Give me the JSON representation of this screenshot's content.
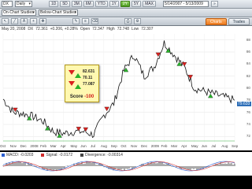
{
  "toolbar": {
    "symbol": "DX",
    "period": "Daily",
    "studies_dropdown": "On-Chart Studies",
    "below_studies_dropdown": "Below-Chart Studies",
    "ranges": [
      "1D",
      "5D",
      "3M",
      "6M",
      "YTD",
      "1Y",
      "2Y",
      "5Y",
      "MAX"
    ],
    "active_range": "2Y",
    "date_range": "5/14/2007 - 5/13/2009",
    "tabs": [
      "Charts",
      "Trades"
    ],
    "active_tab": "Charts"
  },
  "chart_header": {
    "date": "May 20, 2008",
    "symbol": "DX",
    "last": "72.361",
    "change": "+0.206, +0.28%",
    "open_label": "Open",
    "open": "72.347",
    "high_label": "High",
    "high": "72.748",
    "low_label": "Low",
    "low": "72.307",
    "close_label": "Close",
    "close": "72.361"
  },
  "score_box": {
    "values": [
      "82.631",
      "70.11",
      "77.087"
    ],
    "score_label": "Score",
    "score_value": "-100"
  },
  "price_flag": "79.633",
  "y_ticks": [
    "88",
    "86",
    "84",
    "82",
    "80",
    "78",
    "76",
    "74",
    "72"
  ],
  "x_ticks": [
    "Oct",
    "Nov",
    "Dec",
    "2008",
    "Feb",
    "Mar",
    "Apr",
    "May",
    "Jun",
    "Jul",
    "Aug",
    "Sep",
    "Oct",
    "Nov",
    "Dec",
    "2009",
    "Feb",
    "Mar",
    "Apr",
    "May",
    "Jun",
    "Jul",
    "Aug",
    "Sep"
  ],
  "macd": {
    "label": "MACD: -0.0203",
    "signal_label": "Signal: -0.0172",
    "divergence_label": "Divergence: -0.00314",
    "colors": {
      "macd": "#2b5fd1",
      "signal": "#d02b2b",
      "divergence": "#444444"
    }
  },
  "chart_data": {
    "type": "line",
    "x": [
      "Oct 2007",
      "Nov",
      "Dec",
      "Jan 2008",
      "Feb",
      "Mar",
      "Apr",
      "May",
      "Jun",
      "Jul",
      "Aug",
      "Sep",
      "Oct",
      "Nov",
      "Dec",
      "Jan 2009",
      "Feb",
      "Mar",
      "Apr",
      "May",
      "Jun",
      "Jul",
      "Aug",
      "Sep"
    ],
    "series": [
      {
        "values": [
          78.2,
          76.0,
          75.8,
          75.3,
          74.5,
          72.8,
          72.5,
          72.8,
          72.8,
          72.3,
          75.5,
          77.5,
          83.0,
          85.5,
          82.0,
          83.5,
          87.5,
          85.5,
          83.5,
          80.0,
          79.5,
          79.0,
          78.5,
          78.0
        ]
      }
    ],
    "ylim": [
      71,
      89
    ],
    "grid": true
  }
}
